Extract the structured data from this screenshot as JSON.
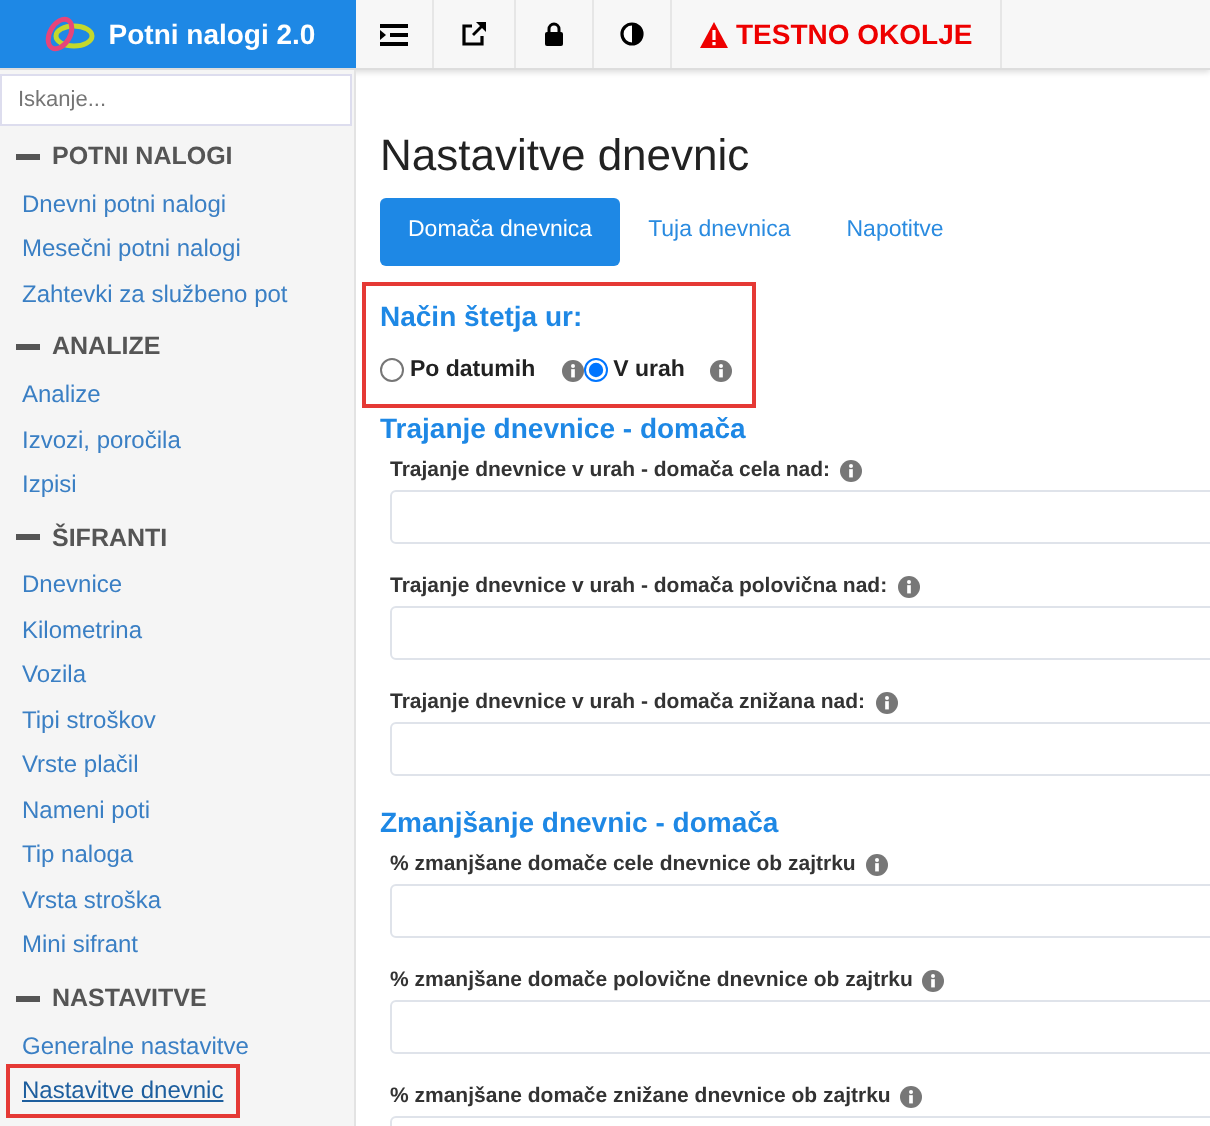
{
  "app": {
    "title": "Potni nalogi 2.0"
  },
  "toolbar": {
    "environment": "TESTNO OKOLJE"
  },
  "search": {
    "placeholder": "Iskanje..."
  },
  "sidebar": {
    "sections": [
      {
        "title": "POTNI NALOGI",
        "expanded": true,
        "items": [
          {
            "label": "Dnevni potni nalogi",
            "selected": false,
            "highlighted": false
          },
          {
            "label": "Mesečni potni nalogi",
            "selected": false,
            "highlighted": false
          },
          {
            "label": "Zahtevki za službeno pot",
            "selected": false,
            "highlighted": false
          }
        ]
      },
      {
        "title": "ANALIZE",
        "expanded": true,
        "items": [
          {
            "label": "Analize",
            "selected": false,
            "highlighted": false
          },
          {
            "label": "Izvozi, poročila",
            "selected": false,
            "highlighted": false
          },
          {
            "label": "Izpisi",
            "selected": false,
            "highlighted": false
          }
        ]
      },
      {
        "title": "ŠIFRANTI",
        "expanded": true,
        "items": [
          {
            "label": "Dnevnice",
            "selected": false,
            "highlighted": false
          },
          {
            "label": "Kilometrina",
            "selected": false,
            "highlighted": false
          },
          {
            "label": "Vozila",
            "selected": false,
            "highlighted": false
          },
          {
            "label": "Tipi stroškov",
            "selected": false,
            "highlighted": false
          },
          {
            "label": "Vrste plačil",
            "selected": false,
            "highlighted": false
          },
          {
            "label": "Nameni poti",
            "selected": false,
            "highlighted": false
          },
          {
            "label": "Tip naloga",
            "selected": false,
            "highlighted": false
          },
          {
            "label": "Vrsta stroška",
            "selected": false,
            "highlighted": false
          },
          {
            "label": "Mini sifrant",
            "selected": false,
            "highlighted": false
          }
        ]
      },
      {
        "title": "NASTAVITVE",
        "expanded": true,
        "items": [
          {
            "label": "Generalne nastavitve",
            "selected": false,
            "highlighted": false
          },
          {
            "label": "Nastavitve dnevnic",
            "selected": true,
            "highlighted": true
          }
        ]
      }
    ]
  },
  "page": {
    "title": "Nastavitve dnevnic",
    "tabs": [
      {
        "label": "Domača dnevnica",
        "selected": true
      },
      {
        "label": "Tuja dnevnica",
        "selected": false
      },
      {
        "label": "Napotitve",
        "selected": false
      }
    ],
    "counting": {
      "title": "Način štetja ur:",
      "highlighted": true,
      "options": [
        {
          "label": "Po datumih",
          "selected": false
        },
        {
          "label": "V urah",
          "selected": true
        }
      ]
    },
    "sections": [
      {
        "title": "Trajanje dnevnice - domača",
        "fields": [
          {
            "label": "Trajanje dnevnice v urah - domača cela nad:"
          },
          {
            "label": "Trajanje dnevnice v urah - domača polovična nad:"
          },
          {
            "label": "Trajanje dnevnice v urah - domača znižana nad:"
          }
        ]
      },
      {
        "title": "Zmanjšanje dnevnic - domača",
        "fields": [
          {
            "label": "% zmanjšane domače cele dnevnice ob zajtrku"
          },
          {
            "label": "% zmanjšane domače polovične dnevnice ob zajtrku"
          },
          {
            "label": "% zmanjšane domače znižane dnevnice ob zajtrku"
          }
        ]
      }
    ]
  }
}
